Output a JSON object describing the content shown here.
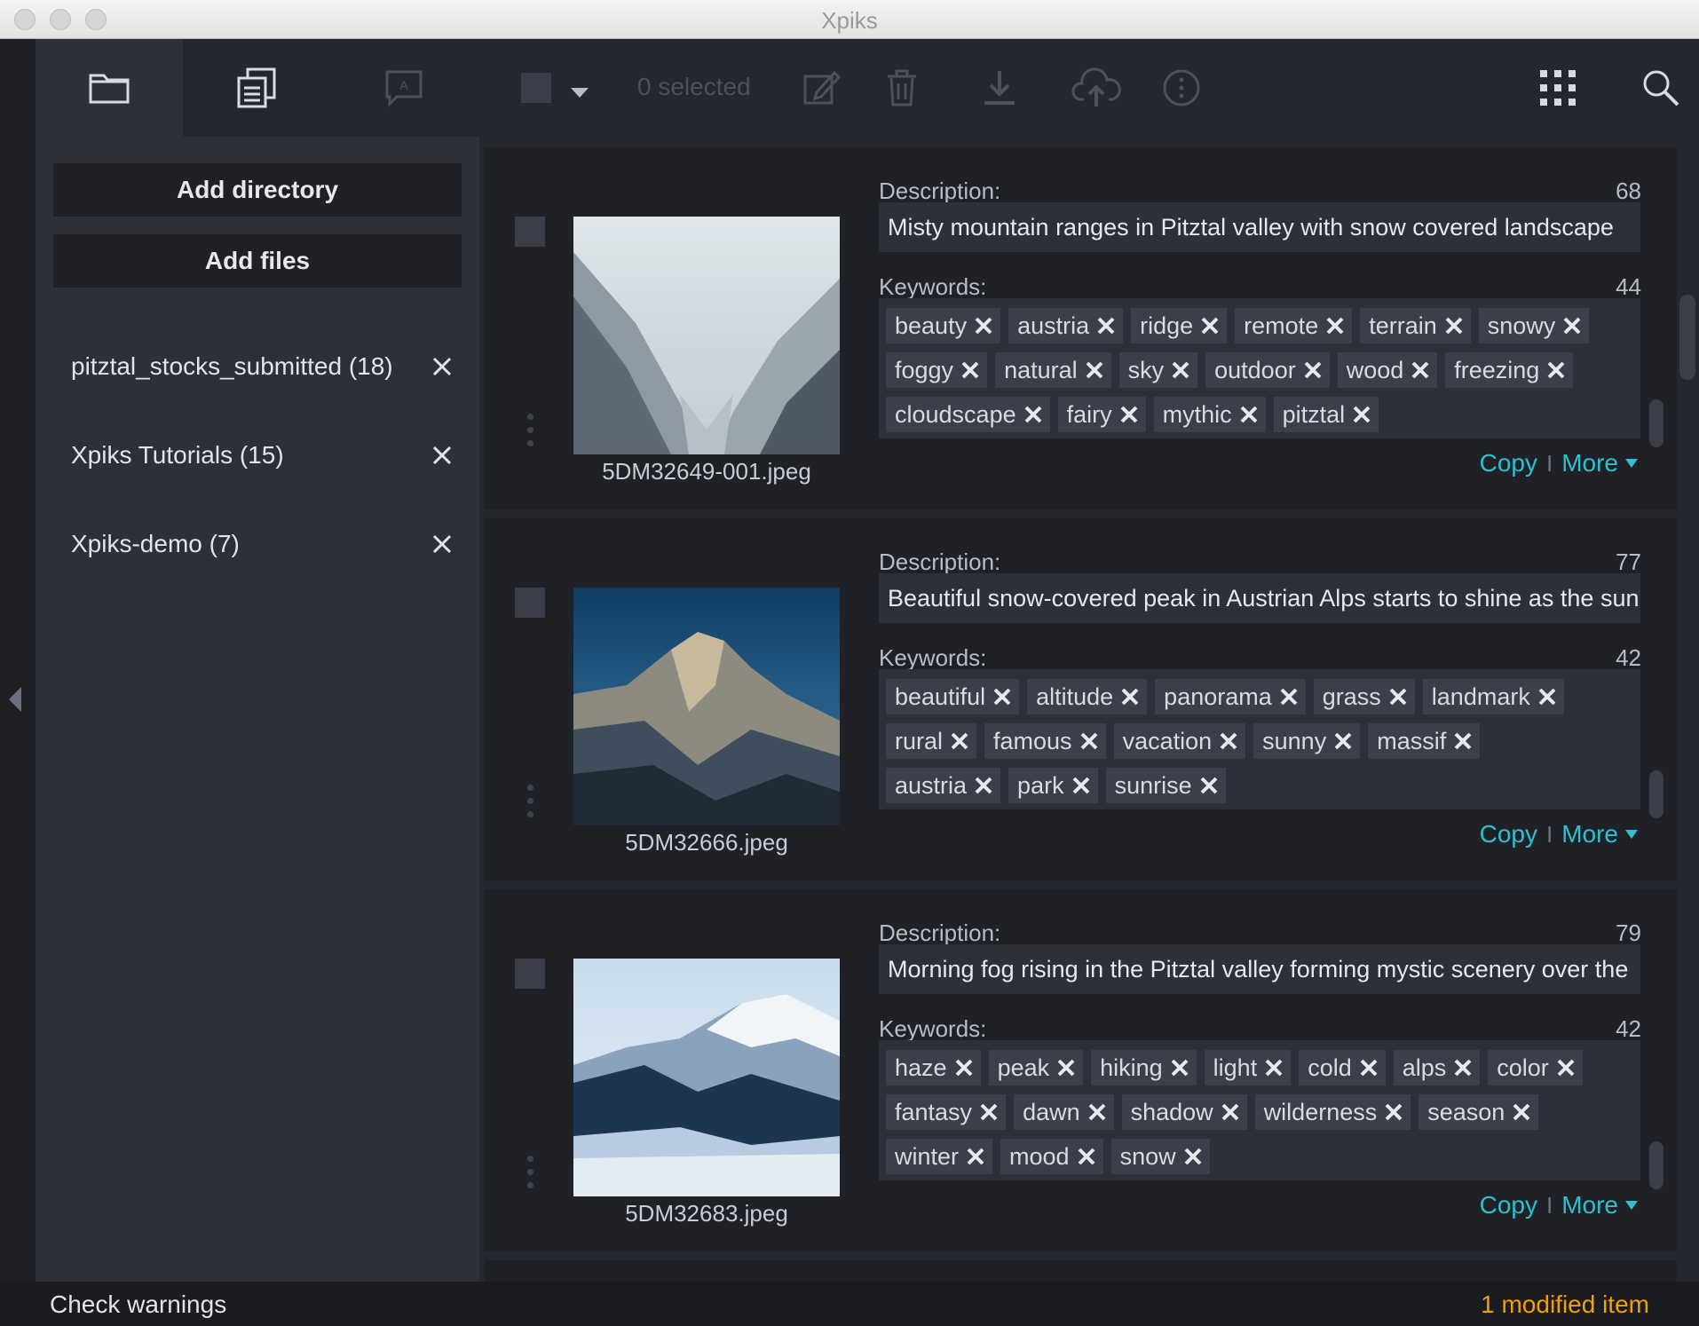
{
  "window": {
    "title": "Xpiks"
  },
  "toolbar": {
    "tabs": [
      {
        "name": "directories",
        "icon": "folder-icon"
      },
      {
        "name": "files",
        "icon": "files-stack-icon"
      },
      {
        "name": "translator",
        "icon": "translation-icon"
      }
    ],
    "selected_text": "0 selected",
    "actions": [
      "select-all-checkbox",
      "select-dropdown-icon",
      "edit-icon",
      "trash-icon",
      "download-icon",
      "upload-cloud-icon",
      "more-icon",
      "grid-view-icon",
      "search-icon"
    ]
  },
  "sidebar": {
    "add_directory": "Add directory",
    "add_files": "Add files",
    "directories": [
      {
        "label": "pitztal_stocks_submitted (18)"
      },
      {
        "label": "Xpiks Tutorials (15)"
      },
      {
        "label": "Xpiks-demo (7)"
      }
    ]
  },
  "artworks": [
    {
      "filename": "5DM32649-001.jpeg",
      "description_label": "Description:",
      "description_count": "68",
      "description": "Misty mountain ranges in Pitztal valley with snow covered landscape",
      "keywords_label": "Keywords:",
      "keywords_count": "44",
      "keyword_rows": [
        [
          "beauty",
          "austria",
          "ridge",
          "remote",
          "terrain",
          "snowy"
        ],
        [
          "foggy",
          "natural",
          "sky",
          "outdoor",
          "wood",
          "freezing"
        ],
        [
          "cloudscape",
          "fairy",
          "mythic",
          "pitztal"
        ]
      ],
      "copy_label": "Copy",
      "separator": "I",
      "more_label": "More"
    },
    {
      "filename": "5DM32666.jpeg",
      "description_label": "Description:",
      "description_count": "77",
      "description": "Beautiful snow-covered peak in Austrian Alps starts to shine as the sun",
      "keywords_label": "Keywords:",
      "keywords_count": "42",
      "keyword_rows": [
        [
          "beautiful",
          "altitude",
          "panorama",
          "grass",
          "landmark"
        ],
        [
          "rural",
          "famous",
          "vacation",
          "sunny",
          "massif"
        ],
        [
          "austria",
          "park",
          "sunrise"
        ]
      ],
      "copy_label": "Copy",
      "separator": "I",
      "more_label": "More"
    },
    {
      "filename": "5DM32683.jpeg",
      "description_label": "Description:",
      "description_count": "79",
      "description": "Morning fog rising in the Pitztal valley forming mystic scenery over the",
      "keywords_label": "Keywords:",
      "keywords_count": "42",
      "keyword_rows": [
        [
          "haze",
          "peak",
          "hiking",
          "light",
          "cold",
          "alps",
          "color"
        ],
        [
          "fantasy",
          "dawn",
          "shadow",
          "wilderness",
          "season"
        ],
        [
          "winter",
          "mood",
          "snow"
        ]
      ],
      "copy_label": "Copy",
      "separator": "I",
      "more_label": "More"
    }
  ],
  "status": {
    "check_warnings": "Check warnings",
    "modified": "1 modified item"
  },
  "colors": {
    "accent_link": "#2fbfd0",
    "modified_orange": "#f0a000",
    "panel": "#2d3039",
    "background": "#24272e"
  }
}
